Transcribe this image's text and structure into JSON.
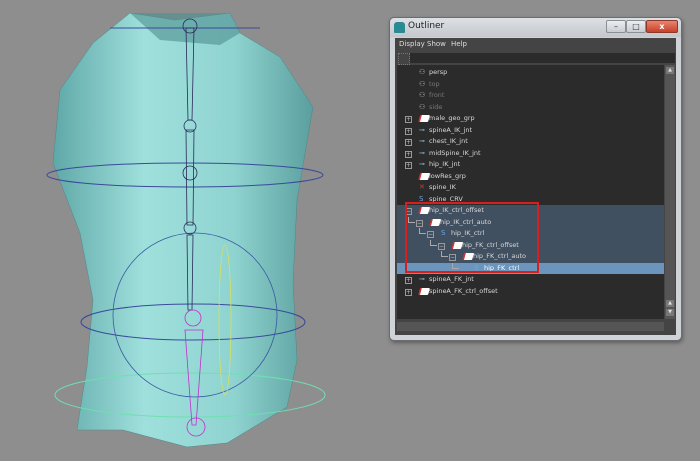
{
  "outliner": {
    "title": "Outliner",
    "window_buttons": {
      "minimize": "–",
      "maximize": "□",
      "close": "x"
    },
    "menus": [
      "Display",
      "Show",
      "Help"
    ],
    "filter_value": "",
    "items": [
      {
        "label": "persp",
        "icon": "camera-icon",
        "depth": 0,
        "expander": "",
        "state": "normal"
      },
      {
        "label": "top",
        "icon": "camera-icon",
        "depth": 0,
        "expander": "",
        "state": "dim"
      },
      {
        "label": "front",
        "icon": "camera-icon",
        "depth": 0,
        "expander": "",
        "state": "dim"
      },
      {
        "label": "side",
        "icon": "camera-icon",
        "depth": 0,
        "expander": "",
        "state": "dim"
      },
      {
        "label": "male_geo_grp",
        "icon": "group-icon",
        "depth": 0,
        "expander": "+",
        "state": "normal"
      },
      {
        "label": "spineA_IK_jnt",
        "icon": "joint-icon",
        "depth": 0,
        "expander": "+",
        "state": "normal"
      },
      {
        "label": "chest_IK_jnt",
        "icon": "joint-icon",
        "depth": 0,
        "expander": "+",
        "state": "normal"
      },
      {
        "label": "midSpine_IK_jnt",
        "icon": "joint-icon",
        "depth": 0,
        "expander": "+",
        "state": "normal"
      },
      {
        "label": "hip_IK_jnt",
        "icon": "joint-icon",
        "depth": 0,
        "expander": "+",
        "state": "normal"
      },
      {
        "label": "lowRes_grp",
        "icon": "group-icon",
        "depth": 0,
        "expander": "",
        "state": "normal"
      },
      {
        "label": "spine_IK",
        "icon": "ik-handle-icon",
        "depth": 0,
        "expander": "",
        "state": "normal"
      },
      {
        "label": "spine_CRV",
        "icon": "curve-icon",
        "depth": 0,
        "expander": "",
        "state": "normal"
      },
      {
        "label": "hip_IK_ctrl_offset",
        "icon": "group-icon",
        "depth": 0,
        "expander": "−",
        "state": "highlight"
      },
      {
        "label": "hip_IK_ctrl_auto",
        "icon": "group-icon",
        "depth": 1,
        "expander": "−",
        "state": "highlight"
      },
      {
        "label": "hip_IK_ctrl",
        "icon": "curve-icon",
        "depth": 2,
        "expander": "−",
        "state": "highlight"
      },
      {
        "label": "hip_FK_ctrl_offset",
        "icon": "group-icon",
        "depth": 3,
        "expander": "−",
        "state": "highlight"
      },
      {
        "label": "hip_FK_ctrl_auto",
        "icon": "group-icon",
        "depth": 4,
        "expander": "−",
        "state": "highlight"
      },
      {
        "label": "hip_FK_ctrl",
        "icon": "curve-icon",
        "depth": 5,
        "expander": "",
        "state": "selected"
      },
      {
        "label": "spineA_FK_jnt",
        "icon": "joint-icon",
        "depth": 0,
        "expander": "+",
        "state": "normal"
      },
      {
        "label": "spineA_FK_ctrl_offset",
        "icon": "group-icon",
        "depth": 0,
        "expander": "+",
        "state": "normal"
      }
    ]
  },
  "colors": {
    "mesh": "#8fd3d3",
    "viewport_bg": "#8e8e8e",
    "selection": "#6b95bd",
    "annotation": "#d62020"
  }
}
